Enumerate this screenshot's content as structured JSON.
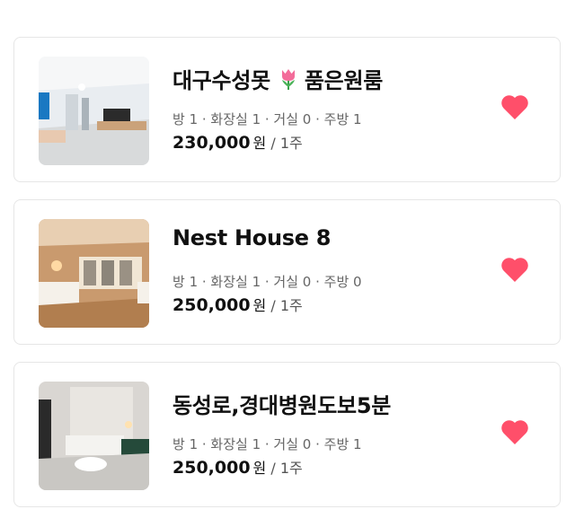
{
  "colors": {
    "heart": "#ff4f6a",
    "specs_text": "#666666",
    "border": "#e6e6e6"
  },
  "listings": [
    {
      "title_part1": "대구수성못",
      "title_icon": "tulip-icon",
      "title_part2": "품은원룸",
      "specs": "방 1 · 화장실 1 · 거실 0 · 주방 1",
      "price": "230,000",
      "unit": "원",
      "period": " / 1주",
      "favorite_icon": "heart-icon"
    },
    {
      "title": "Nest House 8",
      "specs": "방 1 · 화장실 1 · 거실 0 · 주방 0",
      "price": "250,000",
      "unit": "원",
      "period": " / 1주",
      "favorite_icon": "heart-icon"
    },
    {
      "title": "동성로,경대병원도보5분",
      "specs": "방 1 · 화장실 1 · 거실 0 · 주방 1",
      "price": "250,000",
      "unit": "원",
      "period": " / 1주",
      "favorite_icon": "heart-icon"
    }
  ]
}
